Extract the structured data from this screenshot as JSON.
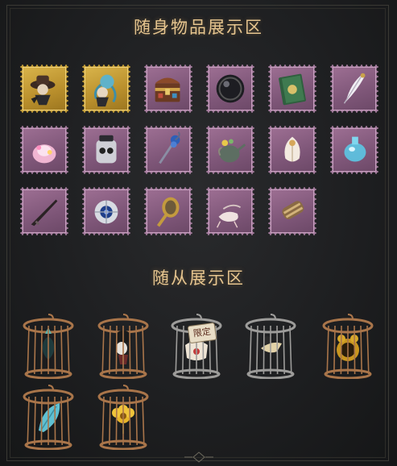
{
  "sections": {
    "items_title": "随身物品展示区",
    "companions_title": "随从展示区"
  },
  "items": [
    {
      "icon": "hat-doll-icon",
      "frame": "gold"
    },
    {
      "icon": "octopus-doll-icon",
      "frame": "gold"
    },
    {
      "icon": "treasure-chest-icon",
      "frame": "pink"
    },
    {
      "icon": "dark-orb-icon",
      "frame": "pink"
    },
    {
      "icon": "green-book-icon",
      "frame": "pink"
    },
    {
      "icon": "feather-quill-icon",
      "frame": "pink"
    },
    {
      "icon": "pink-lamp-icon",
      "frame": "pink"
    },
    {
      "icon": "skull-jar-icon",
      "frame": "pink"
    },
    {
      "icon": "rose-cane-icon",
      "frame": "pink"
    },
    {
      "icon": "watering-can-icon",
      "frame": "pink"
    },
    {
      "icon": "white-flower-icon",
      "frame": "pink"
    },
    {
      "icon": "blue-bottle-icon",
      "frame": "pink"
    },
    {
      "icon": "dagger-icon",
      "frame": "pink"
    },
    {
      "icon": "jeweled-clockwork-icon",
      "frame": "pink"
    },
    {
      "icon": "hand-mirror-icon",
      "frame": "pink"
    },
    {
      "icon": "ballet-shoes-icon",
      "frame": "pink"
    },
    {
      "icon": "scroll-tube-icon",
      "frame": "pink"
    }
  ],
  "companions": [
    {
      "icon": "crowned-bird-cage-icon",
      "badge": ""
    },
    {
      "icon": "masked-figure-cage-icon",
      "badge": ""
    },
    {
      "icon": "paper-scroll-cage-icon",
      "badge": "限定"
    },
    {
      "icon": "bird-skull-cage-icon",
      "badge": ""
    },
    {
      "icon": "golden-clock-cage-icon",
      "badge": ""
    },
    {
      "icon": "blue-leaf-cage-icon",
      "badge": ""
    },
    {
      "icon": "gold-flower-cage-icon",
      "badge": ""
    }
  ],
  "colors": {
    "title": "#e6c58f",
    "stamp_pink": "#a77ea0",
    "stamp_gold": "#c9a23a",
    "cage_dark": "#9d9c9a",
    "cage_bronze": "#a9754a"
  }
}
